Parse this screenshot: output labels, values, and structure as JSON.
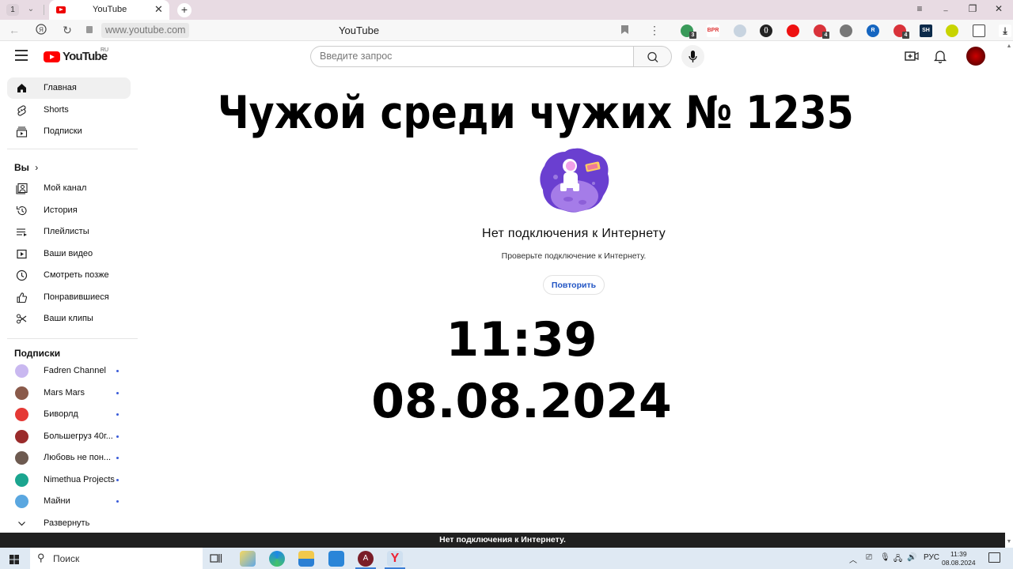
{
  "browser": {
    "tab_count": "1",
    "tab_title": "YouTube",
    "new_tab": "+",
    "url": "www.youtube.com",
    "page_title": "YouTube",
    "back": "←",
    "refresh": "↻",
    "menu": "≡",
    "minimize": "—",
    "restore": "❐",
    "close": "✕",
    "more": "⋮",
    "extensions": [
      {
        "name": "green-extension",
        "color": "#3a9a5a",
        "badge": "3"
      },
      {
        "name": "bpr-extension",
        "color": "#ffffff",
        "text": "BPR",
        "text_color": "#d33"
      },
      {
        "name": "cloud-extension",
        "color": "#c8d4e0"
      },
      {
        "name": "braces-extension",
        "color": "#222222",
        "text": "{}"
      },
      {
        "name": "hand-block-extension",
        "color": "#e11"
      },
      {
        "name": "adblock-extension",
        "color": "#d9323a",
        "badge": "4"
      },
      {
        "name": "bulb-extension",
        "color": "#777777"
      },
      {
        "name": "r-extension",
        "color": "#1565c0",
        "text": "R"
      },
      {
        "name": "adblock-2-extension",
        "color": "#d9323a",
        "badge": "4"
      },
      {
        "name": "sh-extension",
        "color": "#0b2a4a",
        "text": "SH"
      },
      {
        "name": "yellow-extension",
        "color": "#c8d400"
      },
      {
        "name": "sidebar-extension",
        "color": "#ffffff"
      },
      {
        "name": "download-extension",
        "color": "#ffffff",
        "text": "⤓"
      }
    ]
  },
  "header": {
    "logo_text": "YouTube",
    "logo_region": "RU",
    "search_placeholder": "Введите запрос"
  },
  "sidebar": {
    "main": [
      {
        "label": "Главная",
        "icon": "home-icon",
        "active": true
      },
      {
        "label": "Shorts",
        "icon": "shorts-icon"
      },
      {
        "label": "Подписки",
        "icon": "subscriptions-icon"
      }
    ],
    "you_heading": "Вы",
    "you": [
      {
        "label": "Мой канал",
        "icon": "channel-icon"
      },
      {
        "label": "История",
        "icon": "history-icon"
      },
      {
        "label": "Плейлисты",
        "icon": "playlists-icon"
      },
      {
        "label": "Ваши видео",
        "icon": "your-videos-icon"
      },
      {
        "label": "Смотреть позже",
        "icon": "watch-later-icon"
      },
      {
        "label": "Понравившиеся",
        "icon": "liked-icon"
      },
      {
        "label": "Ваши клипы",
        "icon": "clips-icon"
      }
    ],
    "subs_heading": "Подписки",
    "subscriptions": [
      {
        "label": "Fadren Channel",
        "color": "#c9b8f0"
      },
      {
        "label": "Mars Mars",
        "color": "#8a5a4a"
      },
      {
        "label": "Биворлд",
        "color": "#e53935"
      },
      {
        "label": "Большегруз 40г...",
        "color": "#9a2b2b"
      },
      {
        "label": "Любовь не пон...",
        "color": "#6d5a50"
      },
      {
        "label": "Nimethua Projects",
        "color": "#1ba58f"
      },
      {
        "label": "Майни",
        "color": "#5aa7e0"
      }
    ],
    "expand": "Развернуть"
  },
  "main": {
    "overlay_title": "Чужой среди чужих  № 1235",
    "error_title": "Нет подключения к Интернету",
    "error_subtitle": "Проверьте подключение к Интернету.",
    "retry": "Повторить",
    "overlay_time": "11:39",
    "overlay_date": "08.08.2024"
  },
  "toast": "Нет подключения к Интернету.",
  "taskbar": {
    "search_label": "Поиск",
    "language": "РУС",
    "time": "11:39",
    "date": "08.08.2024"
  }
}
